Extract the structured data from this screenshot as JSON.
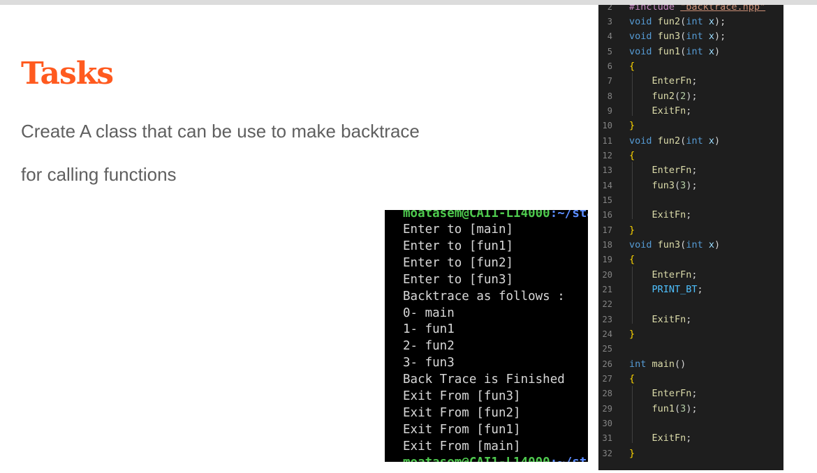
{
  "slide": {
    "title": "Tasks",
    "description_line1": "Create A class that can be use to make backtrace",
    "description_line2": "for calling functions"
  },
  "terminal": {
    "prompt_top_user": "moatasem@CAI1-L14000",
    "prompt_top_path": ":~/sta",
    "lines": [
      "Enter to [main]",
      "Enter to [fun1]",
      "Enter to [fun2]",
      "Enter to [fun3]",
      "Backtrace as follows :",
      "0- main",
      "1- fun1",
      "2- fun2",
      "3- fun3",
      "Back Trace is Finished",
      "Exit From [fun3]",
      "Exit From [fun2]",
      "Exit From [fun1]",
      "Exit From [main]"
    ],
    "prompt_bottom_user": "moatasem@CAI1-L14000",
    "prompt_bottom_path": ":~/sta",
    "colors": {
      "background": "#000000",
      "text": "#d8d8d8",
      "user": "#4ec94e",
      "path": "#5b8cff"
    }
  },
  "editor": {
    "include_directive": "#include",
    "include_file": "\"backtrace.hpp\"",
    "line_numbers": [
      "2",
      "3",
      "4",
      "5",
      "6",
      "7",
      "8",
      "9",
      "10",
      "11",
      "12",
      "13",
      "14",
      "15",
      "16",
      "17",
      "18",
      "19",
      "20",
      "21",
      "22",
      "23",
      "24",
      "25",
      "26",
      "27",
      "28",
      "29",
      "30",
      "31",
      "32"
    ],
    "colors": {
      "background": "#1e1e1e",
      "keyword": "#569cd6",
      "function": "#dcdcaa",
      "variable": "#9cdcfe",
      "number": "#b5cea8",
      "macro": "#4fc1ff",
      "brace": "#ffd700"
    },
    "tokens": {
      "void": "void",
      "int": "int",
      "x": "x",
      "fun1": "fun1",
      "fun2": "fun2",
      "fun3": "fun3",
      "main": "main",
      "EnterFn": "EnterFn",
      "ExitFn": "ExitFn",
      "PRINT_BT": "PRINT_BT",
      "open_brace": "{",
      "close_brace": "}",
      "n2": "2",
      "n3": "3"
    }
  },
  "accent_color": "#ff5a1f"
}
